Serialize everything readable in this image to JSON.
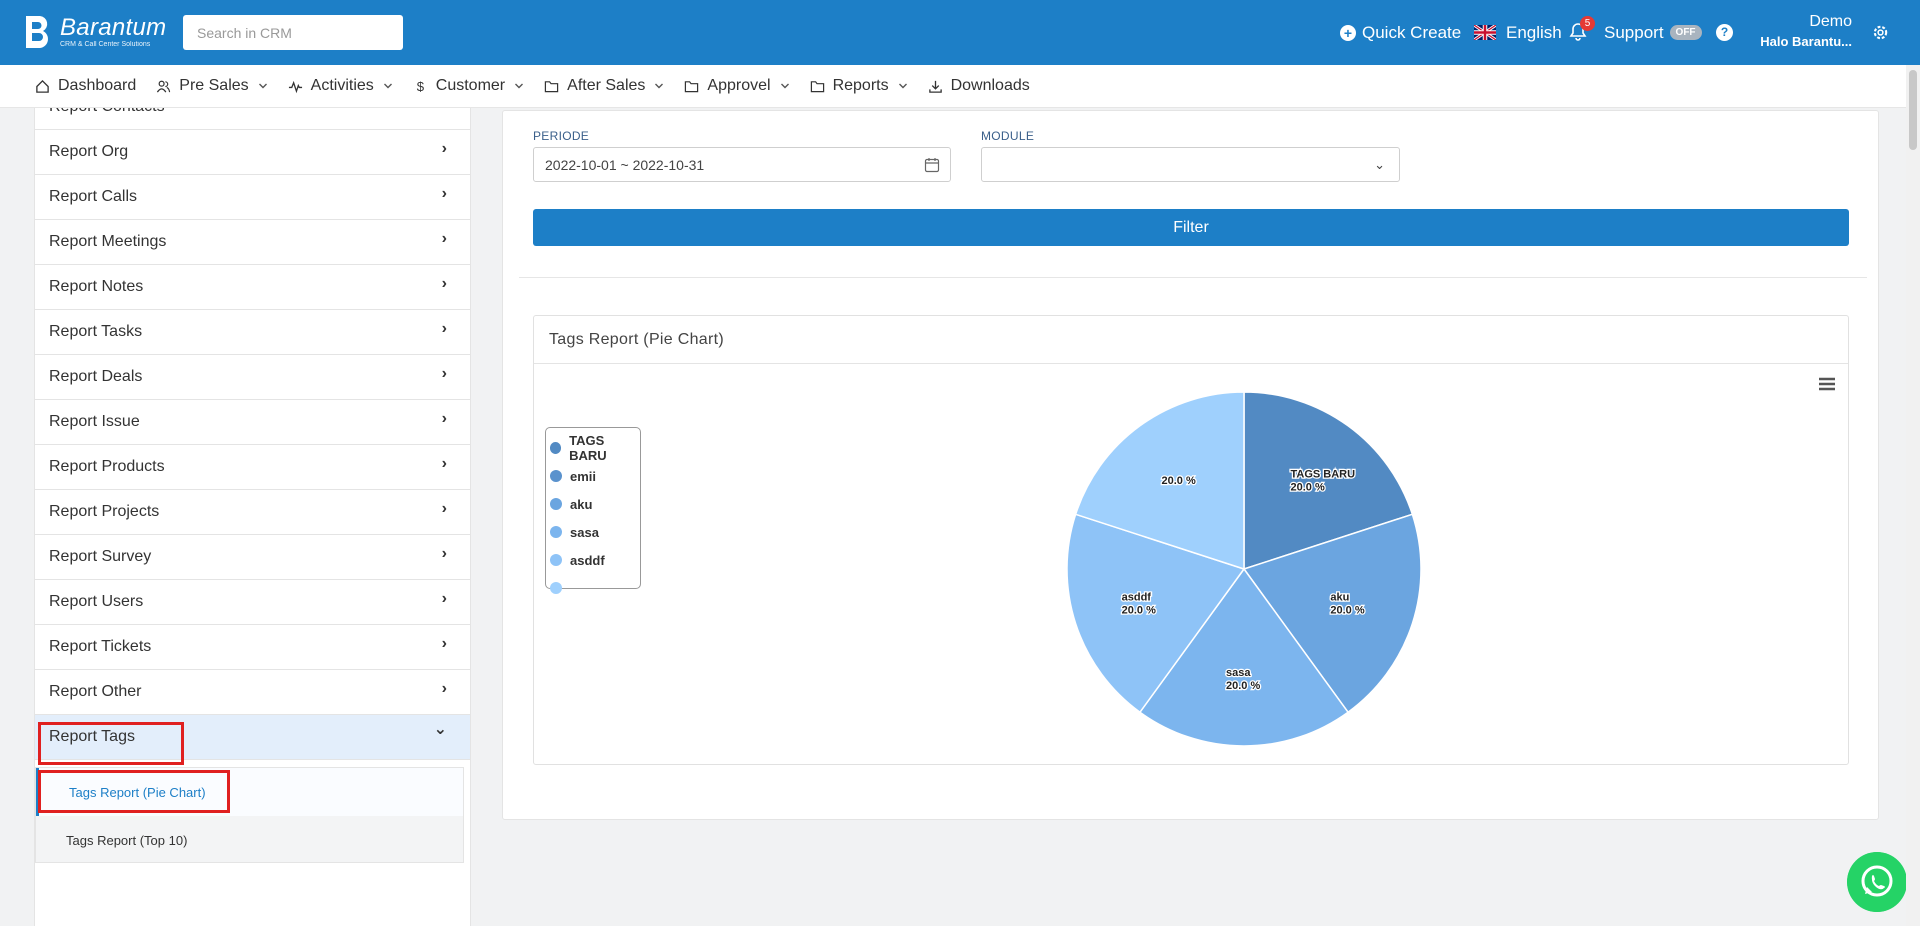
{
  "brand": {
    "name": "Barantum",
    "tagline": "CRM & Call Center Solutions"
  },
  "search": {
    "placeholder": "Search in CRM"
  },
  "topbar": {
    "quick_create": "Quick Create",
    "language": "English",
    "notifications_count": "5",
    "support": "Support",
    "support_toggle": "OFF",
    "help": "?",
    "user_name": "Demo",
    "user_greeting": "Halo Barantu..."
  },
  "nav": {
    "items": [
      {
        "label": "Dashboard",
        "icon": "home-icon"
      },
      {
        "label": "Pre Sales",
        "icon": "users-icon"
      },
      {
        "label": "Activities",
        "icon": "activity-icon"
      },
      {
        "label": "Customer",
        "icon": "dollar-icon"
      },
      {
        "label": "After Sales",
        "icon": "folder-icon"
      },
      {
        "label": "Approvel",
        "icon": "folder-icon"
      },
      {
        "label": "Reports",
        "icon": "folder-icon"
      },
      {
        "label": "Downloads",
        "icon": "download-icon"
      }
    ]
  },
  "sidebar": {
    "items": [
      {
        "label": "Report Contacts"
      },
      {
        "label": "Report Org"
      },
      {
        "label": "Report Calls"
      },
      {
        "label": "Report Meetings"
      },
      {
        "label": "Report Notes"
      },
      {
        "label": "Report Tasks"
      },
      {
        "label": "Report Deals"
      },
      {
        "label": "Report Issue"
      },
      {
        "label": "Report Products"
      },
      {
        "label": "Report Projects"
      },
      {
        "label": "Report Survey"
      },
      {
        "label": "Report Users"
      },
      {
        "label": "Report Tickets"
      },
      {
        "label": "Report Other"
      },
      {
        "label": "Report Tags"
      }
    ],
    "sub_items": [
      {
        "label": "Tags Report (Pie Chart)"
      },
      {
        "label": "Tags Report (Top 10)"
      }
    ]
  },
  "filters": {
    "periode_label": "PERIODE",
    "periode_value": "2022-10-01 ~ 2022-10-31",
    "module_label": "MODULE",
    "module_value": "",
    "filter_button": "Filter"
  },
  "chart_panel": {
    "title": "Tags Report (Pie Chart)"
  },
  "chart_data": {
    "type": "pie",
    "title": "",
    "categories": [
      "TAGS BARU",
      "emii",
      "aku",
      "sasa",
      "asddf",
      ""
    ],
    "slices": [
      {
        "name": "TAGS BARU",
        "value": 20.0,
        "label": "TAGS BARU",
        "pct_label": "20.0 %",
        "color": "#528ac3"
      },
      {
        "name": "emii",
        "value": 0,
        "label": "",
        "pct_label": "",
        "color": "#5a92cd"
      },
      {
        "name": "aku",
        "value": 20.0,
        "label": "aku",
        "pct_label": "20.0 %",
        "color": "#6ba5e0"
      },
      {
        "name": "sasa",
        "value": 20.0,
        "label": "sasa",
        "pct_label": "20.0 %",
        "color": "#7cb5ee"
      },
      {
        "name": "asddf",
        "value": 20.0,
        "label": "asddf",
        "pct_label": "20.0 %",
        "color": "#8ec3f7"
      },
      {
        "name": "",
        "value": 20.0,
        "label": "",
        "pct_label": "20.0 %",
        "color": "#9fd0fd"
      }
    ],
    "legend_placement": "left"
  }
}
